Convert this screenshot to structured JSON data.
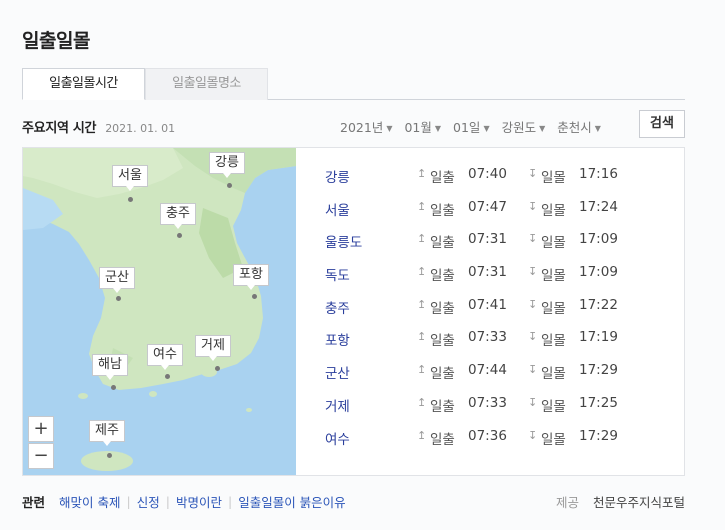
{
  "page_title": "일출일몰",
  "tabs": [
    {
      "label": "일출일몰시간",
      "active": true
    },
    {
      "label": "일출일몰명소",
      "active": false
    }
  ],
  "subhead": {
    "label": "주요지역 시간",
    "date": "2021. 01. 01"
  },
  "filters": {
    "year": "2021년",
    "month": "01월",
    "day": "01일",
    "province": "강원도",
    "city": "춘천시",
    "search_label": "검색"
  },
  "map": {
    "pins": [
      "강릉",
      "서울",
      "충주",
      "군산",
      "포항",
      "해남",
      "여수",
      "거제",
      "제주"
    ],
    "zoom_in": "+",
    "zoom_out": "−"
  },
  "labels": {
    "sunrise": "일출",
    "sunset": "일몰",
    "sunrise_icon": "↥",
    "sunset_icon": "↧"
  },
  "rows": [
    {
      "city": "강릉",
      "sunrise": "07:40",
      "sunset": "17:16"
    },
    {
      "city": "서울",
      "sunrise": "07:47",
      "sunset": "17:24"
    },
    {
      "city": "울릉도",
      "sunrise": "07:31",
      "sunset": "17:09"
    },
    {
      "city": "독도",
      "sunrise": "07:31",
      "sunset": "17:09"
    },
    {
      "city": "충주",
      "sunrise": "07:41",
      "sunset": "17:22"
    },
    {
      "city": "포항",
      "sunrise": "07:33",
      "sunset": "17:19"
    },
    {
      "city": "군산",
      "sunrise": "07:44",
      "sunset": "17:29"
    },
    {
      "city": "거제",
      "sunrise": "07:33",
      "sunset": "17:25"
    },
    {
      "city": "여수",
      "sunrise": "07:36",
      "sunset": "17:29"
    }
  ],
  "footer": {
    "related_label": "관련",
    "links": [
      "해맞이 축제",
      "신정",
      "박명이란",
      "일출일몰이 붉은이유"
    ],
    "provider_label": "제공",
    "provider_name": "천문우주지식포털"
  },
  "colors": {
    "city_link": "#2b3f9c",
    "footer_link": "#2b55b8",
    "sea": "#a9d2f0",
    "land": "#cfe6c0"
  }
}
